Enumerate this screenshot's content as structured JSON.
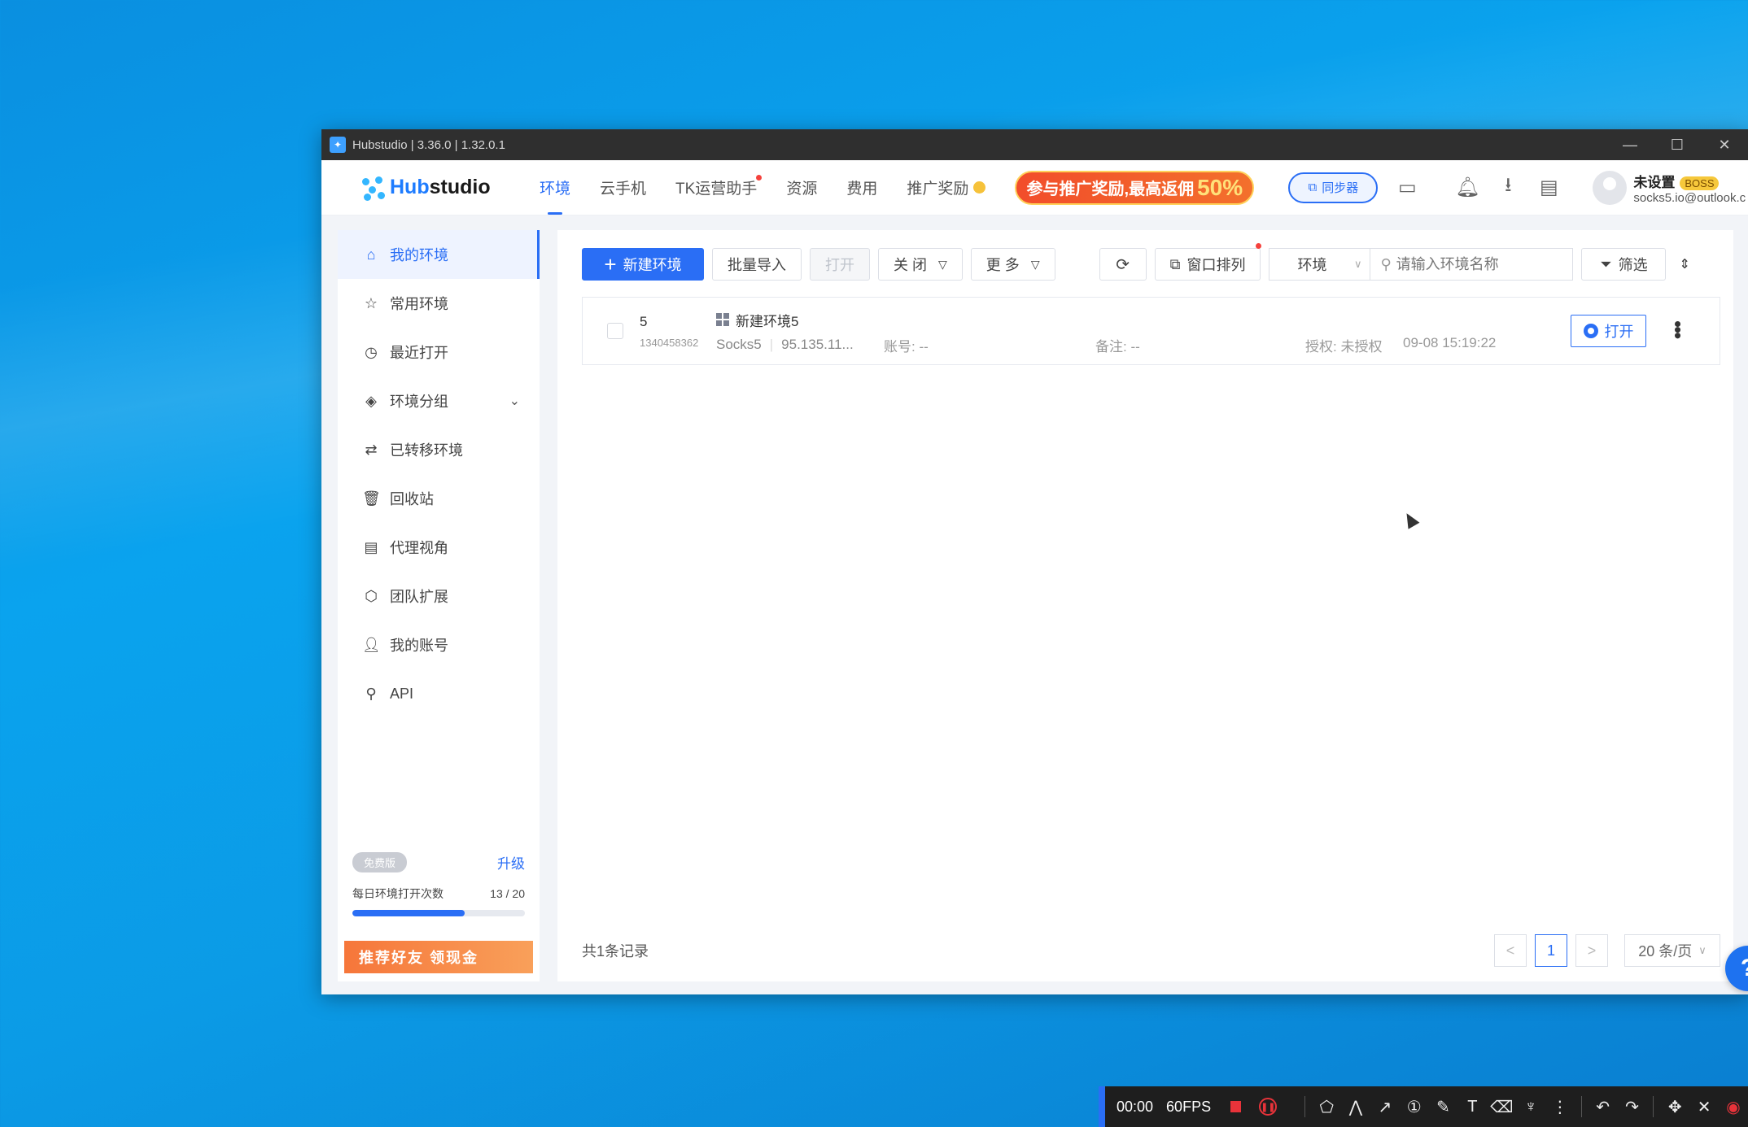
{
  "window": {
    "title": "Hubstudio | 3.36.0 | 1.32.0.1",
    "controls": {
      "minimize": "—",
      "maximize": "☐",
      "close": "✕"
    }
  },
  "brand": {
    "prefix": "Hub",
    "suffix": "studio"
  },
  "nav": {
    "items": [
      {
        "label": "环境"
      },
      {
        "label": "云手机"
      },
      {
        "label": "TK运营助手"
      },
      {
        "label": "资源"
      },
      {
        "label": "费用"
      },
      {
        "label": "推广奖励"
      }
    ],
    "promo": {
      "text": "参与推广奖励,最高返佣",
      "highlight": "50%"
    },
    "sync_label": "同步器"
  },
  "user": {
    "name": "未设置",
    "badge": "BOSS",
    "email": "socks5.io@outlook.c"
  },
  "sidebar": {
    "items": [
      {
        "label": "我的环境"
      },
      {
        "label": "常用环境"
      },
      {
        "label": "最近打开"
      },
      {
        "label": "环境分组"
      },
      {
        "label": "已转移环境"
      },
      {
        "label": "回收站"
      },
      {
        "label": "代理视角"
      },
      {
        "label": "团队扩展"
      },
      {
        "label": "我的账号"
      },
      {
        "label": "API"
      }
    ],
    "plan": {
      "badge": "免费版",
      "upgrade": "升级",
      "quota_label": "每日环境打开次数",
      "quota_value": "13 / 20",
      "quota_fraction": 0.65
    },
    "refer_banner": "推荐好友 领现金"
  },
  "toolbar": {
    "new_env": "新建环境",
    "batch_import": "批量导入",
    "open": "打开",
    "close": "关 闭",
    "more": "更 多",
    "window_arrange": "窗口排列",
    "env_select": "环境",
    "search_placeholder": "请输入环境名称",
    "filter": "筛选"
  },
  "table": {
    "rows": [
      {
        "serial": "5",
        "id": "1340458362",
        "name": "新建环境5",
        "proxy_type": "Socks5",
        "ip": "95.135.11...",
        "account": "账号: --",
        "note": "备注: --",
        "auth": "授权: 未授权",
        "time": "09-08 15:19:22",
        "open_label": "打开"
      }
    ]
  },
  "footer": {
    "total": "共1条记录",
    "prev": "<",
    "page": "1",
    "next": ">",
    "page_size": "20 条/页"
  },
  "help_label": "?",
  "recorder": {
    "time": "00:00",
    "fps": "60FPS"
  }
}
